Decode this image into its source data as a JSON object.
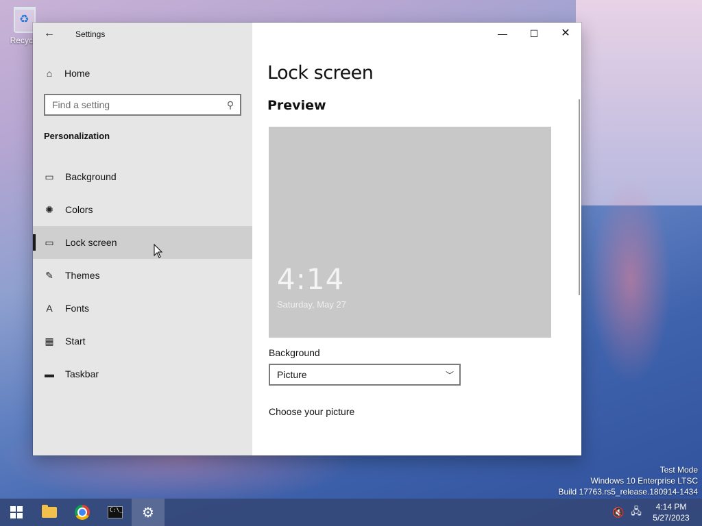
{
  "desktop": {
    "recycle_bin_label": "Recycle"
  },
  "window": {
    "title": "Settings",
    "back_icon": "←",
    "minimize_icon": "—",
    "maximize_icon": "☐",
    "close_icon": "✕"
  },
  "sidebar": {
    "home_label": "Home",
    "search_placeholder": "Find a setting",
    "section_title": "Personalization",
    "items": [
      {
        "label": "Background",
        "icon": "picture-icon",
        "glyph": "▭"
      },
      {
        "label": "Colors",
        "icon": "palette-icon",
        "glyph": "✺"
      },
      {
        "label": "Lock screen",
        "icon": "lock-screen-icon",
        "glyph": "▭",
        "selected": true
      },
      {
        "label": "Themes",
        "icon": "themes-icon",
        "glyph": "✎"
      },
      {
        "label": "Fonts",
        "icon": "fonts-icon",
        "glyph": "A"
      },
      {
        "label": "Start",
        "icon": "start-icon",
        "glyph": "▦"
      },
      {
        "label": "Taskbar",
        "icon": "taskbar-icon",
        "glyph": "▬"
      }
    ]
  },
  "main": {
    "title": "Lock screen",
    "preview_title": "Preview",
    "preview_time": "4:14",
    "preview_date": "Saturday, May 27",
    "background_label": "Background",
    "background_value": "Picture",
    "choose_label": "Choose your picture"
  },
  "watermark": {
    "line1": "Test Mode",
    "line2": "Windows 10 Enterprise LTSC",
    "line3": "Build 17763.rs5_release.180914-1434"
  },
  "taskbar": {
    "time": "4:14 PM",
    "date": "5/27/2023"
  }
}
